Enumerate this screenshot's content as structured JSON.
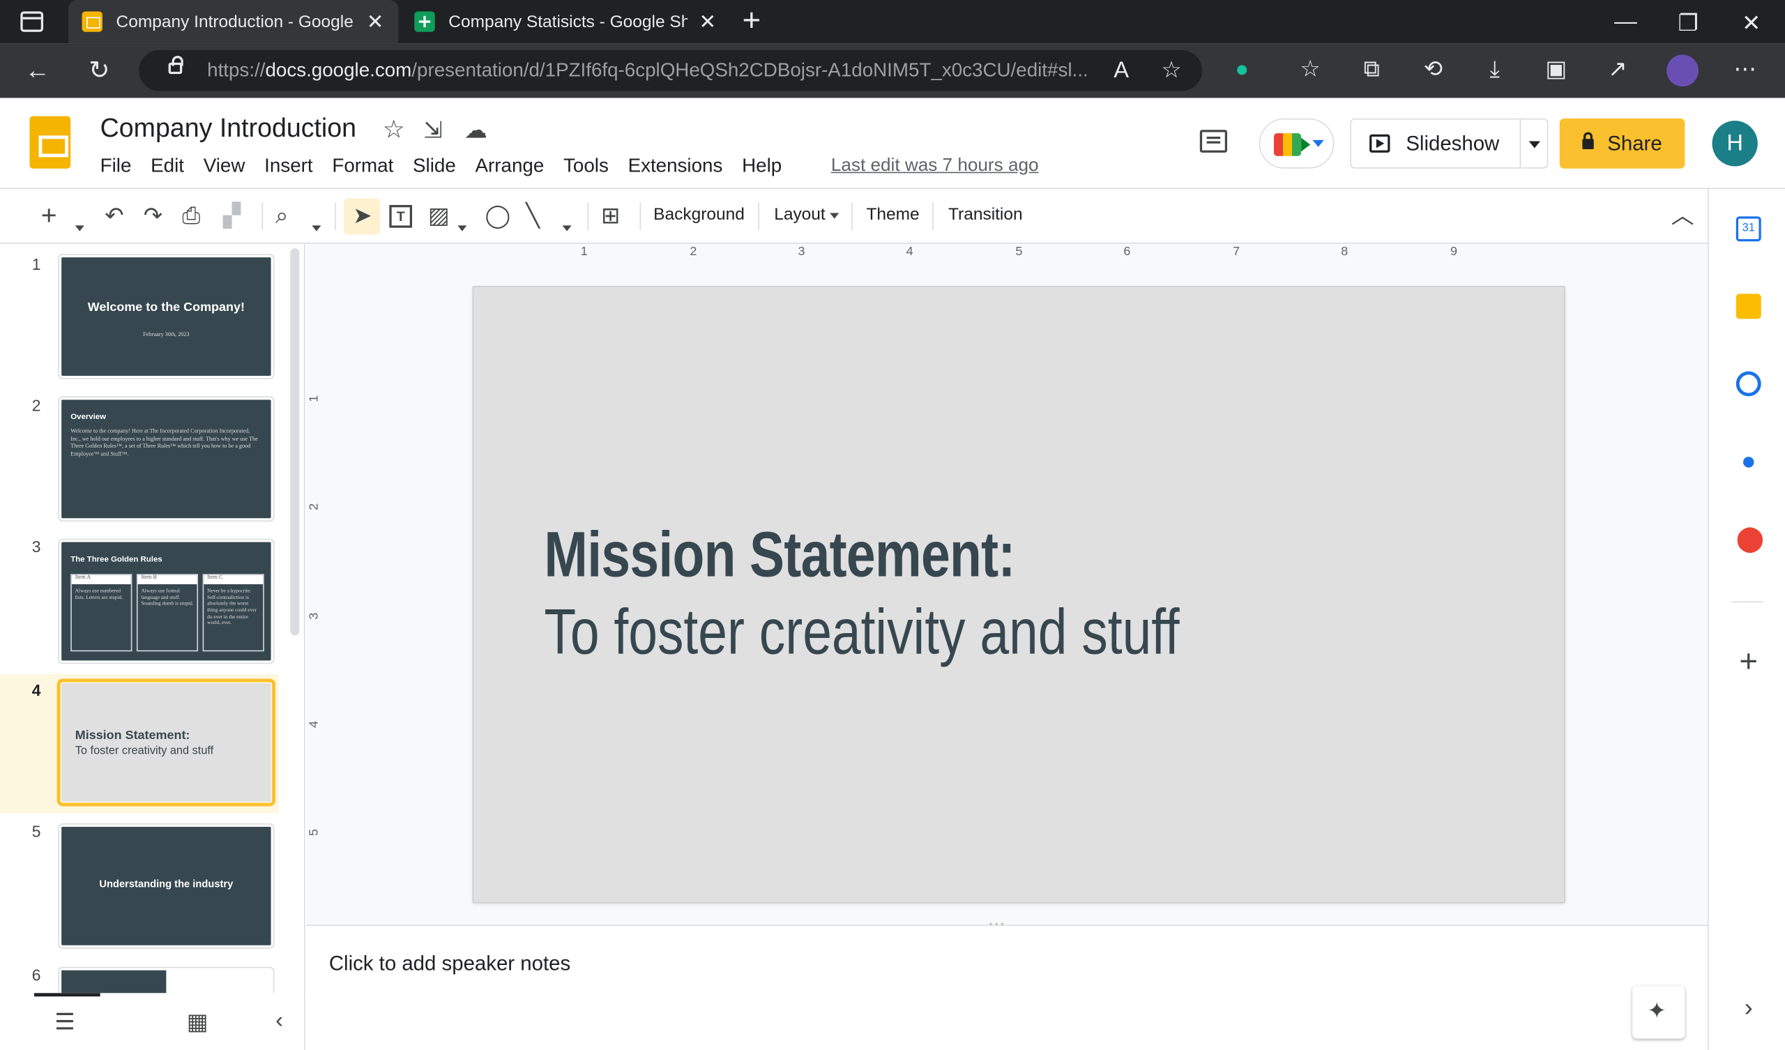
{
  "browser": {
    "tabs": [
      {
        "title": "Company Introduction - Google Slides",
        "active": true
      },
      {
        "title": "Company Statisicts - Google Sheets",
        "active": false
      }
    ],
    "url_prefix": "https://",
    "url_domain": "docs.google.com",
    "url_path": "/presentation/d/1PZIf6fq-6cplQHeQSh2CDBojsr-A1doNIM5T_x0c3CU/edit#sl..."
  },
  "doc": {
    "title": "Company Introduction",
    "menu": [
      "File",
      "Edit",
      "View",
      "Insert",
      "Format",
      "Slide",
      "Arrange",
      "Tools",
      "Extensions",
      "Help"
    ],
    "last_edit": "Last edit was 7 hours ago",
    "slideshow_label": "Slideshow",
    "share_label": "Share",
    "avatar_initial": "H"
  },
  "toolbar": {
    "background_label": "Background",
    "layout_label": "Layout",
    "theme_label": "Theme",
    "transition_label": "Transition"
  },
  "ruler": {
    "h_marks": [
      "1",
      "2",
      "3",
      "4",
      "5",
      "6",
      "7",
      "8",
      "9"
    ],
    "v_marks": [
      "1",
      "2",
      "3",
      "4",
      "5"
    ]
  },
  "slides": [
    {
      "number": "1",
      "title": "Welcome to the Company!",
      "subtitle": "February 30th, 2023"
    },
    {
      "number": "2",
      "title": "Overview",
      "body": "Welcome to the company! Here at The Incorporated Corporation Incorporated, Inc., we hold our employees to a higher standard and stuff. That's why we use The Three Golden Rules™, a set of Three Rules™ which tell you how to be a good Employee™ and Stuff™."
    },
    {
      "number": "3",
      "title": "The Three Golden Rules",
      "columns": [
        {
          "head": "Item A",
          "body": "Always use numbered lists. Letters are stupid."
        },
        {
          "head": "Item B",
          "body": "Always use formal language and stuff. Sounding dumb is stupid."
        },
        {
          "head": "Item C",
          "body": "Never be a hypocrite. Self-contradiction is absolutely the worst thing anyone could ever do ever in the entire world, ever."
        }
      ]
    },
    {
      "number": "4",
      "title": "Mission Statement:",
      "subtitle": "To foster creativity and stuff",
      "selected": true
    },
    {
      "number": "5",
      "title": "Understanding the industry"
    },
    {
      "number": "6"
    }
  ],
  "current_slide": {
    "title": "Mission Statement:",
    "subtitle": "To foster creativity and stuff"
  },
  "notes": {
    "placeholder": "Click to add speaker notes"
  },
  "colors": {
    "slide_dark": "#37474f",
    "accent_yellow": "#fbc02d",
    "avatar": "#1b7f87"
  }
}
